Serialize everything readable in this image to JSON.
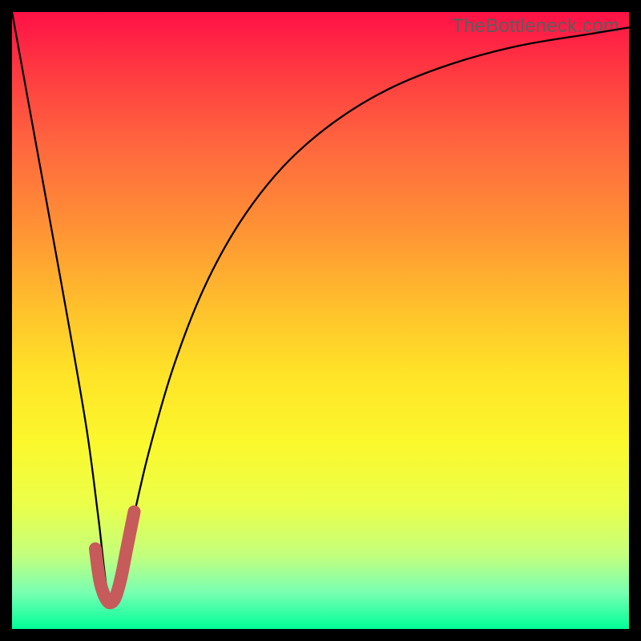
{
  "watermark": {
    "text": "TheBottleneck.com"
  },
  "colors": {
    "frame": "#000000",
    "curve_main": "#000000",
    "curve_accent": "#c75a5a",
    "gradient_stops": [
      "#ff1147",
      "#ff3b41",
      "#ff683e",
      "#ff9235",
      "#ffc12c",
      "#ffe427",
      "#fbf82d",
      "#eaff4a",
      "#c4ff7c",
      "#7affb2",
      "#00ff98"
    ]
  },
  "chart_data": {
    "type": "line",
    "title": "",
    "xlabel": "",
    "ylabel": "",
    "xlim": [
      0,
      100
    ],
    "ylim": [
      0,
      100
    ],
    "note": "Axes unlabeled; values are percent of inner plot area (0 at bottom-left).",
    "series": [
      {
        "name": "main-curve",
        "x": [
          0,
          4,
          8,
          12,
          14,
          15.5,
          17,
          19,
          22,
          26,
          31,
          37,
          44,
          52,
          61,
          71,
          82,
          94,
          100
        ],
        "y": [
          100,
          78,
          56,
          33,
          18,
          6,
          7,
          15,
          28,
          42,
          55,
          66,
          75,
          82,
          87.5,
          91.5,
          94.5,
          96.5,
          97.5
        ]
      },
      {
        "name": "accent-hook",
        "x": [
          13.5,
          14.3,
          15.5,
          16.6,
          17.6,
          18.6,
          19.8
        ],
        "y": [
          13,
          7.5,
          4.5,
          4.8,
          8,
          13,
          19
        ]
      }
    ]
  }
}
